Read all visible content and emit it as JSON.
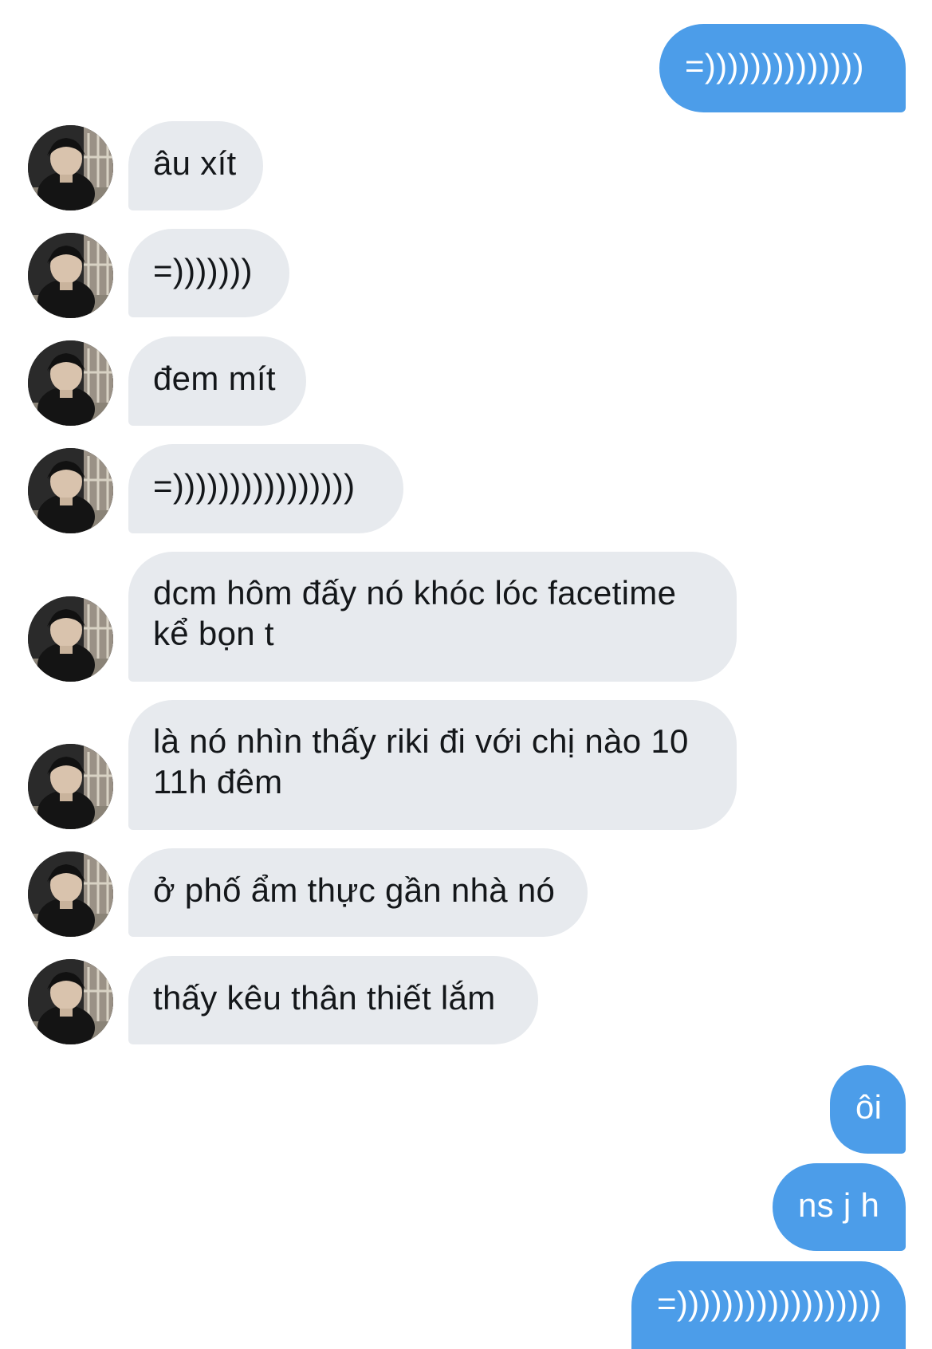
{
  "conversation": {
    "messages": [
      {
        "sender": "me",
        "text": "=))))))))))))))"
      },
      {
        "sender": "them",
        "text": "âu xít"
      },
      {
        "sender": "them",
        "text": "=)))))))"
      },
      {
        "sender": "them",
        "text": "đem mít"
      },
      {
        "sender": "them",
        "text": "=))))))))))))))))"
      },
      {
        "sender": "them",
        "text": "dcm hôm đấy nó khóc lóc facetime kể bọn t"
      },
      {
        "sender": "them",
        "text": "là nó nhìn thấy riki đi với chị nào 10 11h đêm"
      },
      {
        "sender": "them",
        "text": "ở phố ẩm thực gần nhà nó"
      },
      {
        "sender": "them",
        "text": "thấy kêu thân thiết lắm"
      },
      {
        "sender": "me",
        "text": "ôi"
      },
      {
        "sender": "me",
        "text": "ns j h"
      },
      {
        "sender": "me",
        "text": "=))))))))))))))))))"
      }
    ]
  },
  "colors": {
    "outgoing_bubble": "#4c9de9",
    "incoming_bubble": "#e7eaee",
    "incoming_text": "#14171a",
    "outgoing_text": "#ffffff",
    "background": "#ffffff"
  },
  "icons": {
    "contact_avatar": "contact-avatar-photo"
  }
}
